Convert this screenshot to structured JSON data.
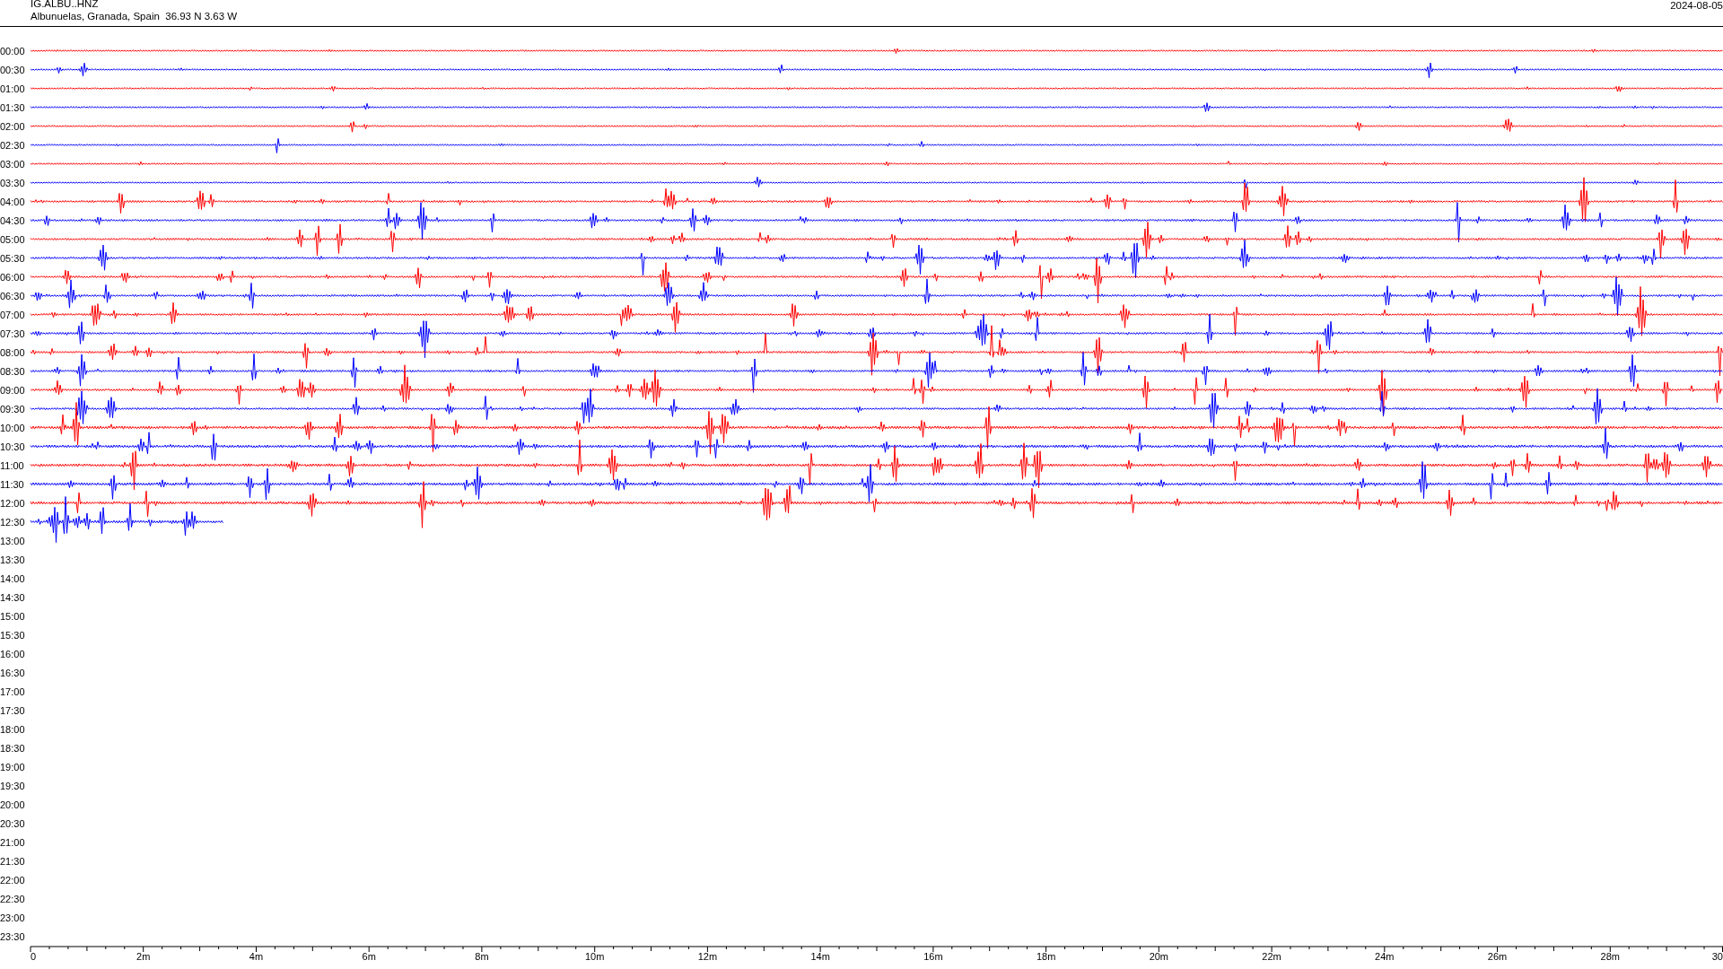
{
  "header": {
    "station": "IG.ALBU..HNZ",
    "location": "Albunuelas, Granada, Spain  36.93 N 3.63 W",
    "date": "2024-08-05"
  },
  "rows": [
    {
      "time": "00:00",
      "kind": "full",
      "color": "#ff0000"
    },
    {
      "time": "00:30",
      "kind": "full",
      "color": "#0000ff"
    },
    {
      "time": "01:00",
      "kind": "full",
      "color": "#ff0000"
    },
    {
      "time": "01:30",
      "kind": "full",
      "color": "#0000ff"
    },
    {
      "time": "02:00",
      "kind": "full",
      "color": "#ff0000"
    },
    {
      "time": "02:30",
      "kind": "full",
      "color": "#0000ff"
    },
    {
      "time": "03:00",
      "kind": "full",
      "color": "#ff0000"
    },
    {
      "time": "03:30",
      "kind": "full",
      "color": "#0000ff"
    },
    {
      "time": "04:00",
      "kind": "full",
      "color": "#ff0000"
    },
    {
      "time": "04:30",
      "kind": "full",
      "color": "#0000ff"
    },
    {
      "time": "05:00",
      "kind": "full",
      "color": "#ff0000"
    },
    {
      "time": "05:30",
      "kind": "full",
      "color": "#0000ff"
    },
    {
      "time": "06:00",
      "kind": "full",
      "color": "#ff0000"
    },
    {
      "time": "06:30",
      "kind": "full",
      "color": "#0000ff"
    },
    {
      "time": "07:00",
      "kind": "full",
      "color": "#ff0000"
    },
    {
      "time": "07:30",
      "kind": "full",
      "color": "#0000ff"
    },
    {
      "time": "08:00",
      "kind": "full",
      "color": "#ff0000"
    },
    {
      "time": "08:30",
      "kind": "full",
      "color": "#0000ff"
    },
    {
      "time": "09:00",
      "kind": "full",
      "color": "#ff0000"
    },
    {
      "time": "09:30",
      "kind": "full",
      "color": "#0000ff"
    },
    {
      "time": "10:00",
      "kind": "full",
      "color": "#ff0000"
    },
    {
      "time": "10:30",
      "kind": "full",
      "color": "#0000ff"
    },
    {
      "time": "11:00",
      "kind": "full",
      "color": "#ff0000"
    },
    {
      "time": "11:30",
      "kind": "full",
      "color": "#0000ff"
    },
    {
      "time": "12:00",
      "kind": "full",
      "color": "#ff0000"
    },
    {
      "time": "12:30",
      "kind": "partial",
      "color": "#0000ff"
    },
    {
      "time": "13:00",
      "kind": "none"
    },
    {
      "time": "13:30",
      "kind": "none"
    },
    {
      "time": "14:00",
      "kind": "none"
    },
    {
      "time": "14:30",
      "kind": "none"
    },
    {
      "time": "15:00",
      "kind": "none"
    },
    {
      "time": "15:30",
      "kind": "none"
    },
    {
      "time": "16:00",
      "kind": "none"
    },
    {
      "time": "16:30",
      "kind": "none"
    },
    {
      "time": "17:00",
      "kind": "none"
    },
    {
      "time": "17:30",
      "kind": "none"
    },
    {
      "time": "18:00",
      "kind": "none"
    },
    {
      "time": "18:30",
      "kind": "none"
    },
    {
      "time": "19:00",
      "kind": "none"
    },
    {
      "time": "19:30",
      "kind": "none"
    },
    {
      "time": "20:00",
      "kind": "none"
    },
    {
      "time": "20:30",
      "kind": "none"
    },
    {
      "time": "21:00",
      "kind": "none"
    },
    {
      "time": "21:30",
      "kind": "none"
    },
    {
      "time": "22:00",
      "kind": "none"
    },
    {
      "time": "22:30",
      "kind": "none"
    },
    {
      "time": "23:00",
      "kind": "none"
    },
    {
      "time": "23:30",
      "kind": "none"
    }
  ],
  "axis": {
    "tick_labels": [
      "0",
      "2m",
      "4m",
      "6m",
      "8m",
      "10m",
      "12m",
      "14m",
      "16m",
      "18m",
      "20m",
      "22m",
      "24m",
      "26m",
      "28m",
      "30"
    ]
  }
}
